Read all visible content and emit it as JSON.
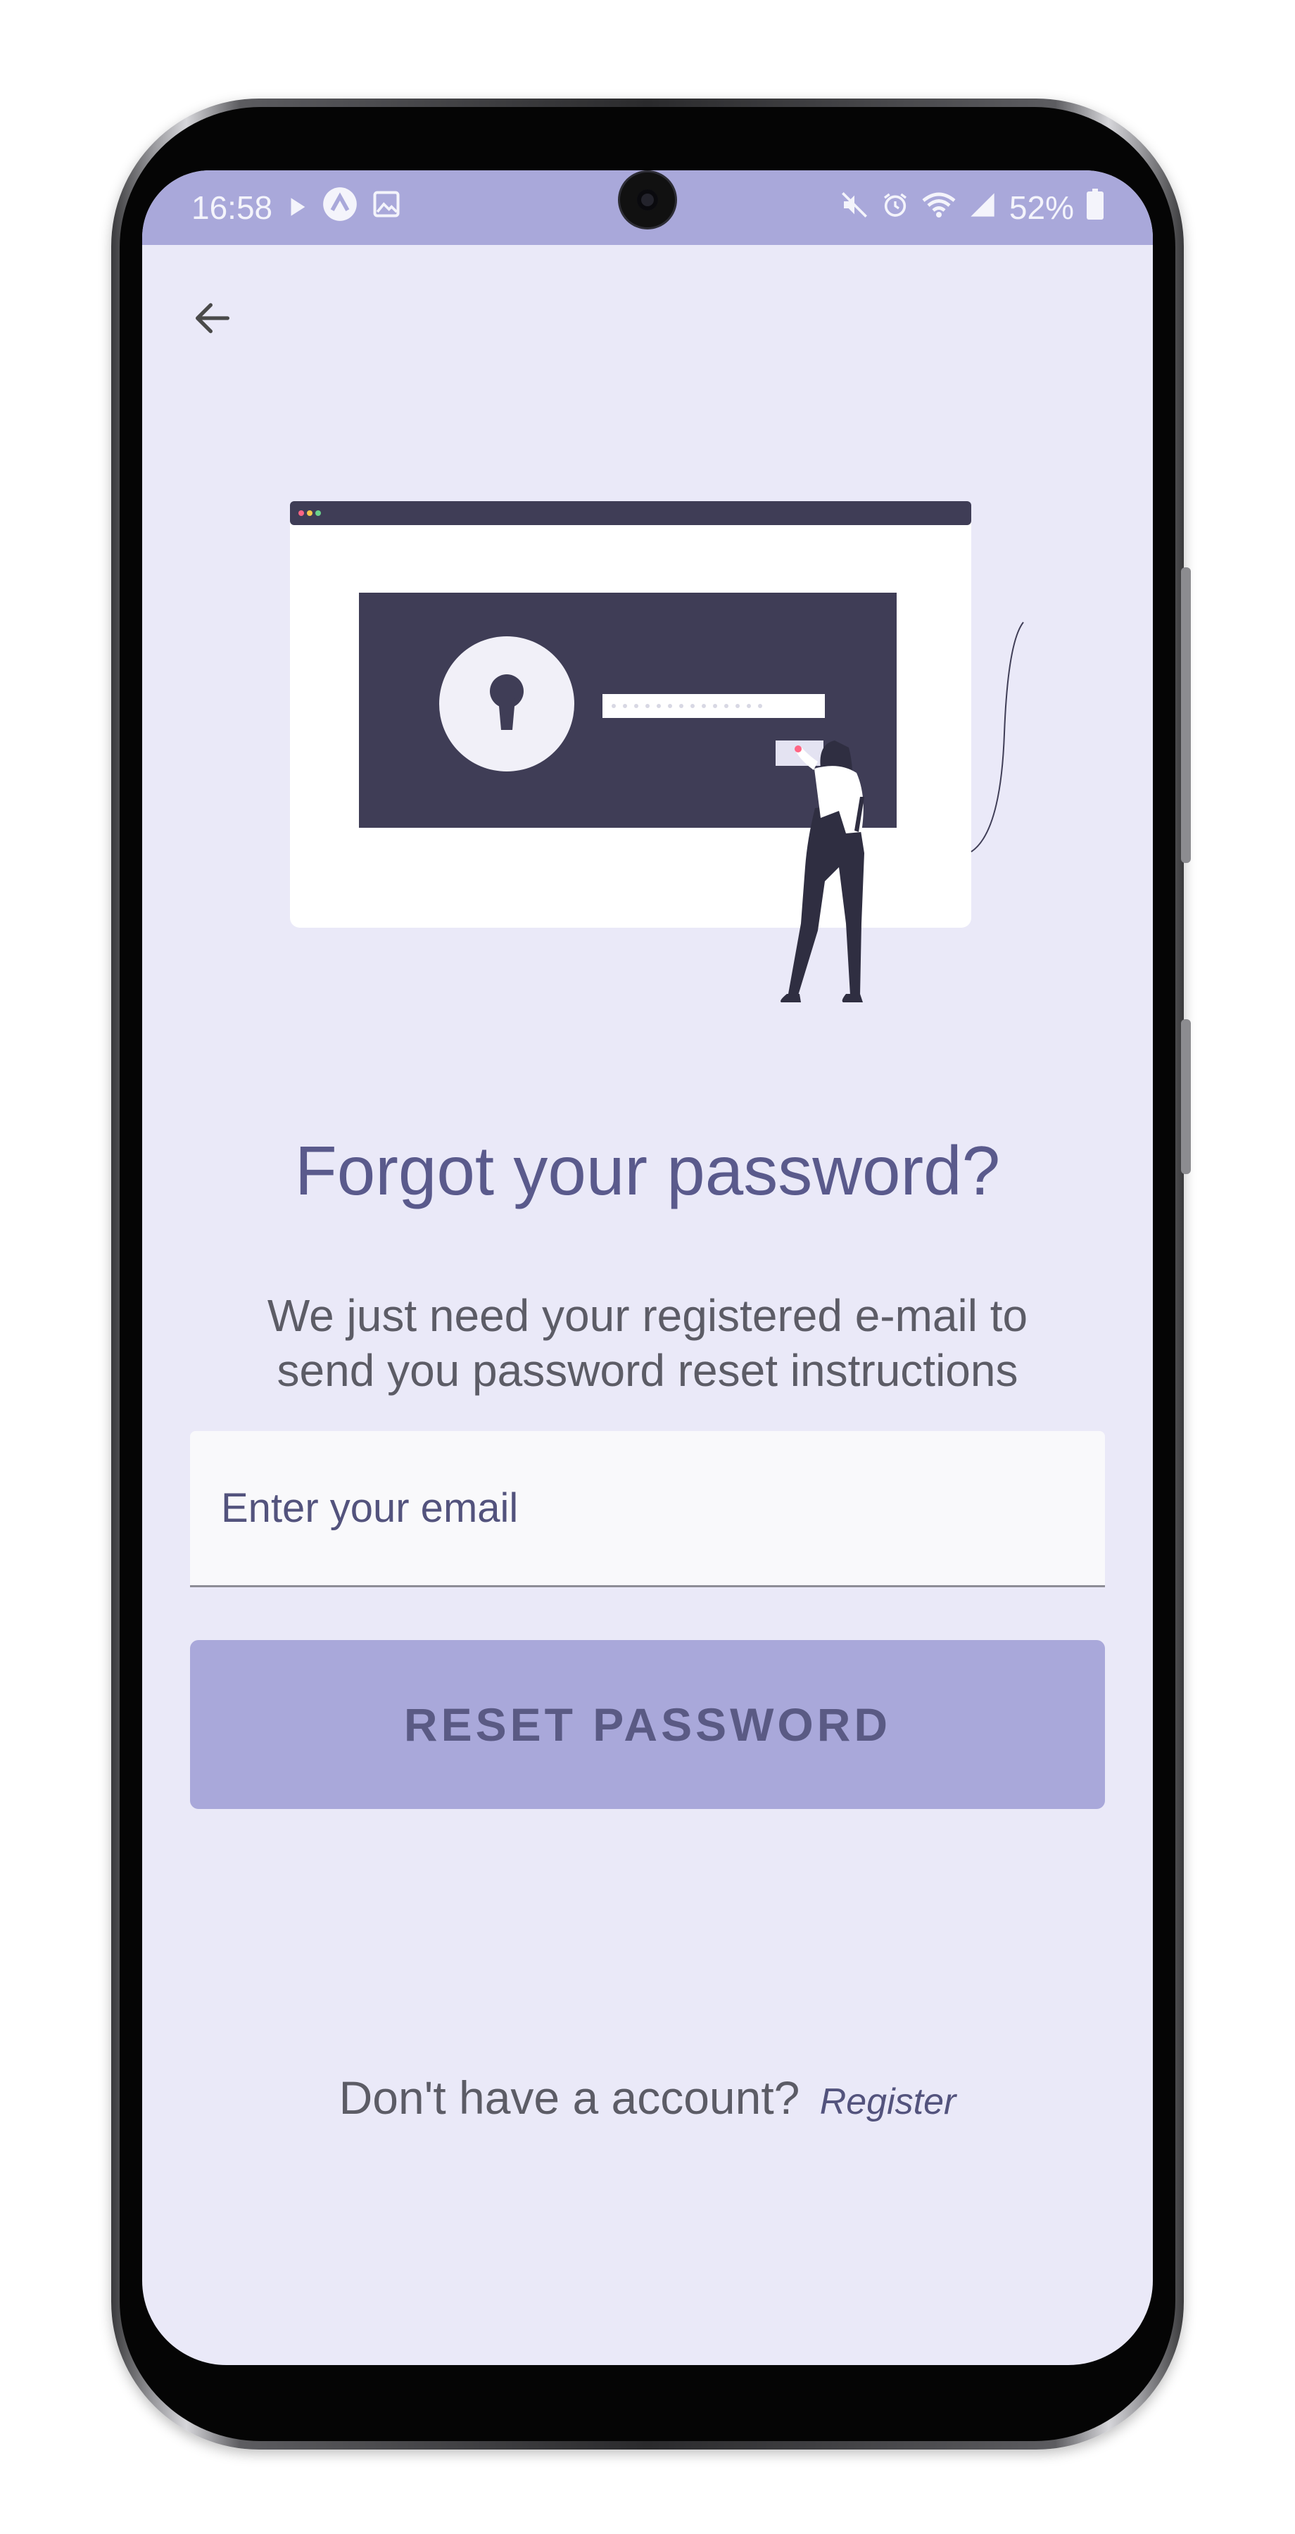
{
  "status_bar": {
    "time": "16:58",
    "battery": "52%",
    "left_icons": [
      "play-icon",
      "app-logo-icon",
      "gallery-icon"
    ],
    "right_icons": [
      "mute-icon",
      "alarm-icon",
      "wifi-icon",
      "signal-icon",
      "battery-icon"
    ]
  },
  "navigation": {
    "back_icon": "arrow-left-icon"
  },
  "main": {
    "title": "Forgot your password?",
    "subtitle_line1": "We just need your registered e-mail to",
    "subtitle_line2": "send you password reset instructions",
    "email_placeholder": "Enter your email",
    "email_value": "",
    "reset_button": "RESET PASSWORD",
    "register_prompt": "Don't have a account?",
    "register_link": "Register"
  },
  "colors": {
    "screen_bg": "#eae9f8",
    "accent": "#a9a8da",
    "title": "#5a5a8c",
    "illustration_dark": "#3f3d56"
  }
}
